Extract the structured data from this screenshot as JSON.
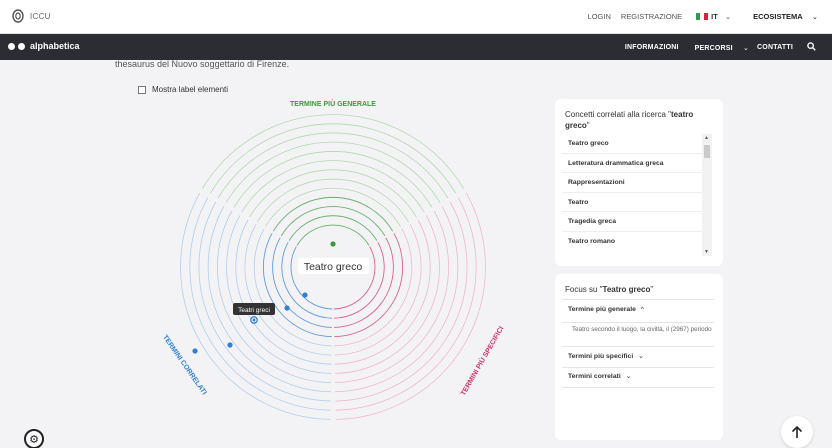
{
  "topbar": {
    "org": "ICCU",
    "login": "LOGIN",
    "register": "REGISTRAZIONE",
    "language": "IT",
    "ecosystem": "ECOSISTEMA"
  },
  "navbar": {
    "brand": "alphabetica",
    "menu": [
      {
        "label": "INFORMAZIONI"
      },
      {
        "label": "PERCORSI"
      },
      {
        "label": "CONTATTI"
      }
    ]
  },
  "intro_text": "thesaurus del Nuovo soggettario di Firenze.",
  "show_labels_checkbox": "Mostra label elementi",
  "graph": {
    "label_top": "TERMINE PIÙ GENERALE",
    "label_left": "TERMINI CORRELATI",
    "label_right": "TERMINI PIÙ SPECIFICI",
    "center_term": "Teatro greco",
    "tooltip": "Teatri greci",
    "colors": {
      "general": "#3c9a3c",
      "related": "#2f7fd4",
      "specific": "#d4306a"
    }
  },
  "related_panel": {
    "title_prefix": "Concetti correlati alla ricerca \"",
    "title_term": "teatro greco",
    "title_suffix": "\"",
    "items": [
      "Teatro greco",
      "Letteratura drammatica greca",
      "Rappresentazioni",
      "Teatro",
      "Tragedia greca",
      "Teatro romano"
    ]
  },
  "focus_panel": {
    "title_prefix": "Focus su \"",
    "title_term": "Teatro greco",
    "title_suffix": "\"",
    "general_label": "Termine più generale",
    "general_detail": "Teatro secondo il luogo, la civiltà, il (2967) periodo",
    "specific_label": "Termini più specifici",
    "related_label": "Termini correlati"
  }
}
